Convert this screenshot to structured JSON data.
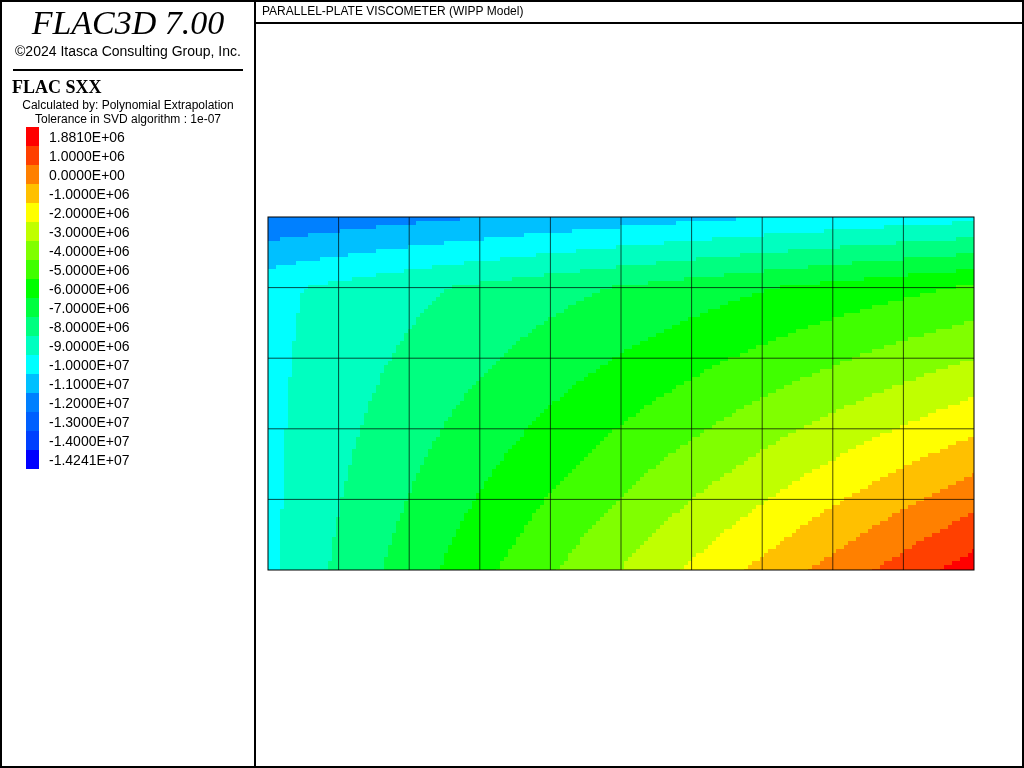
{
  "app": {
    "title": "FLAC3D 7.00",
    "copyright": "©2024 Itasca Consulting Group, Inc."
  },
  "legend": {
    "title": "FLAC SXX",
    "notes": [
      "Calculated by: Polynomial Extrapolation",
      "Tolerance in SVD algorithm : 1e-07"
    ],
    "items": [
      {
        "label": "1.8810E+06",
        "color": "#ff0000"
      },
      {
        "label": "1.0000E+06",
        "color": "#ff4000"
      },
      {
        "label": "0.0000E+00",
        "color": "#ff8000"
      },
      {
        "label": "-1.0000E+06",
        "color": "#ffc000"
      },
      {
        "label": "-2.0000E+06",
        "color": "#ffff00"
      },
      {
        "label": "-3.0000E+06",
        "color": "#c0ff00"
      },
      {
        "label": "-4.0000E+06",
        "color": "#80ff00"
      },
      {
        "label": "-5.0000E+06",
        "color": "#40ff00"
      },
      {
        "label": "-6.0000E+06",
        "color": "#00ff00"
      },
      {
        "label": "-7.0000E+06",
        "color": "#00ff40"
      },
      {
        "label": "-8.0000E+06",
        "color": "#00ff80"
      },
      {
        "label": "-9.0000E+06",
        "color": "#00ffc0"
      },
      {
        "label": "-1.0000E+07",
        "color": "#00ffff"
      },
      {
        "label": "-1.1000E+07",
        "color": "#00c0ff"
      },
      {
        "label": "-1.2000E+07",
        "color": "#0080ff"
      },
      {
        "label": "-1.3000E+07",
        "color": "#0060ff"
      },
      {
        "label": "-1.4000E+07",
        "color": "#0040ff"
      },
      {
        "label": "-1.4241E+07",
        "color": "#0000ff"
      }
    ]
  },
  "plot": {
    "title": "PARALLEL-PLATE VISCOMETER (WIPP Model)"
  }
}
